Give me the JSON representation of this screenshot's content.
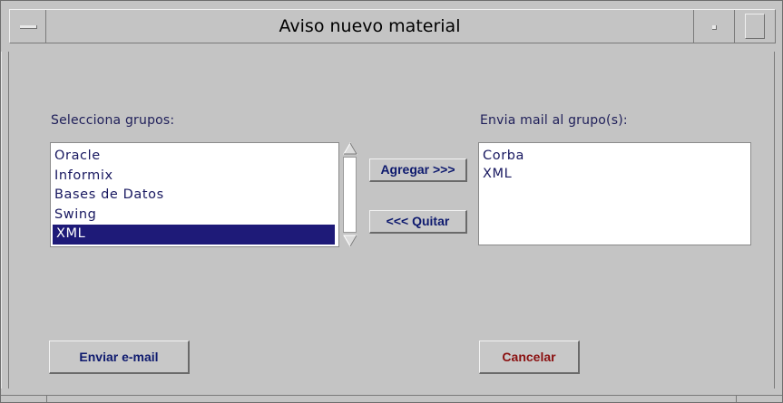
{
  "window": {
    "title": "Aviso nuevo material"
  },
  "available_groups": {
    "label": "Selecciona grupos:",
    "items": [
      "Oracle",
      "Informix",
      "Bases de Datos",
      "Swing",
      "XML"
    ],
    "selected": "XML"
  },
  "target_groups": {
    "label": "Envia mail al grupo(s):",
    "items": [
      "Corba",
      "XML"
    ]
  },
  "buttons": {
    "add": "Agregar >>>",
    "remove": "<<< Quitar",
    "send": "Enviar e-mail",
    "cancel": "Cancelar"
  },
  "colors": {
    "background": "#c4c4c4",
    "selection": "#1e1a78",
    "label_text": "#20205a",
    "cancel_text": "#8a1010"
  }
}
